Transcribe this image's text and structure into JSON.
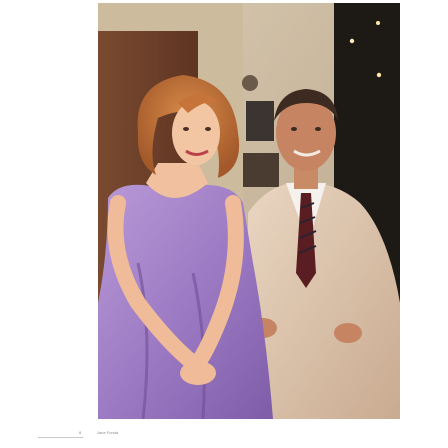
{
  "page": {
    "number": "8",
    "running_head": "Jane Fonda"
  },
  "photo": {
    "subject": "photograph"
  }
}
